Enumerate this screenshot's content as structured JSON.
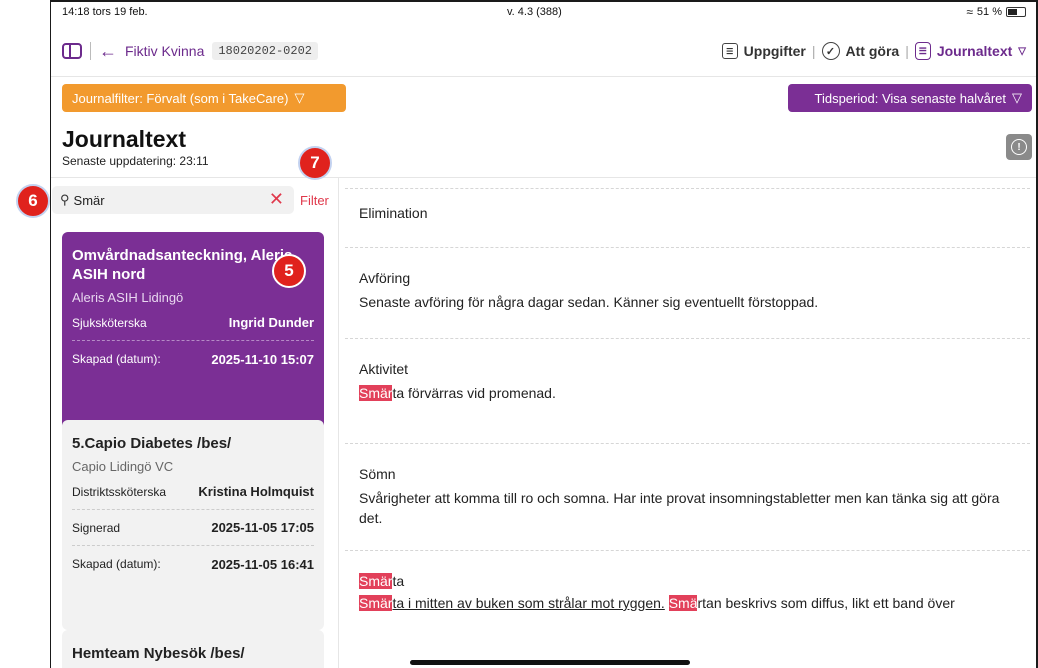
{
  "status_bar": {
    "time": "14:18  tors 19 feb.",
    "version": "v. 4.3 (388)",
    "battery": "51 %"
  },
  "nav": {
    "patient_name": "Fiktiv Kvinna",
    "patient_id": "18020202-0202",
    "tasks": "Uppgifter",
    "todo": "Att göra",
    "journal": "Journaltext"
  },
  "filters": {
    "journal_filter": "Journalfilter: Förvalt (som i TakeCare)",
    "period": "Tidsperiod: Visa senaste halvåret"
  },
  "header": {
    "title": "Journaltext",
    "last_updated": "Senaste uppdatering: 23:11"
  },
  "search": {
    "value": "Smär",
    "filter_label": "Filter"
  },
  "badges": {
    "five": "5",
    "six": "6",
    "seven": "7"
  },
  "cards": [
    {
      "title": "Omvårdnadsanteckning, Aleris ASIH nord",
      "org": "Aleris ASIH Lidingö",
      "rows": [
        {
          "label": "Sjuksköterska",
          "value": "Ingrid Dunder"
        },
        {
          "label": "Skapad (datum):",
          "value": "2025-11-10 15:07"
        }
      ]
    },
    {
      "title": "5.Capio Diabetes /bes/",
      "org": "Capio Lidingö VC",
      "rows": [
        {
          "label": "Distriktssköterska",
          "value": "Kristina Holmquist"
        },
        {
          "label": "Signerad",
          "value": "2025-11-05 17:05"
        },
        {
          "label": "Skapad (datum):",
          "value": "2025-11-05 16:41"
        }
      ]
    },
    {
      "title": "Hemteam Nybesök /bes/"
    }
  ],
  "content": {
    "elimination": "Elimination",
    "avforing_heading": "Avföring",
    "avforing_body": "Senaste avföring för några dagar sedan. Känner sig eventuellt förstoppad.",
    "aktivitet_heading": "Aktivitet",
    "aktivitet_hl": "Smär",
    "aktivitet_rest": "ta förvärras vid promenad.",
    "somn_heading": "Sömn",
    "somn_body": "Svårigheter att komma till ro och somna. Har inte provat insomningstabletter men kan tänka sig att göra det.",
    "smarta_heading_hl": "Smär",
    "smarta_heading_rest": "ta",
    "smarta_hl1": "Smär",
    "smarta_text1": "ta i mitten av buken som strålar mot ryggen.",
    "smarta_hl2": "Smä",
    "smarta_text2": "rtan beskrivs som diffus, likt ett band över"
  }
}
